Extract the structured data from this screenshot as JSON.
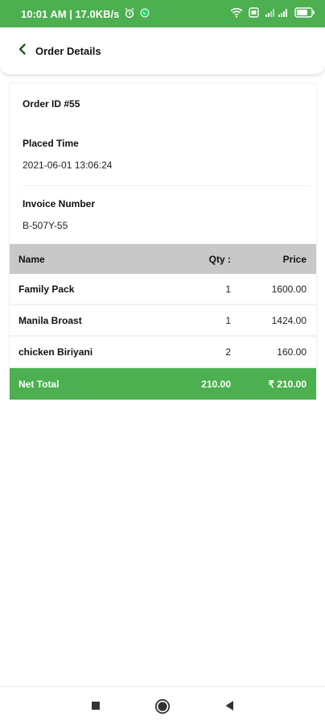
{
  "status_bar": {
    "time_speed": "10:01 AM | 17.0KB/s",
    "icons": [
      "alarm-icon",
      "whatsapp-icon",
      "wifi-icon",
      "sim-icon",
      "signal-icon",
      "battery-icon"
    ],
    "battery": "63",
    "bg_color": "#4CAF50"
  },
  "app_bar": {
    "title": "Order Details",
    "back_icon": "chevron-left-icon"
  },
  "order": {
    "order_id": "Order ID #55",
    "placed_label": "Placed Time",
    "placed_value": "2021-06-01 13:06:24",
    "invoice_label": "Invoice Number",
    "invoice_value": "B-507Y-55"
  },
  "table": {
    "headers": {
      "name": "Name",
      "qty": "Qty :",
      "price": "Price"
    },
    "items": [
      {
        "name": "Family Pack",
        "qty": "1",
        "price": "1600.00"
      },
      {
        "name": "Manila Broast",
        "qty": "1",
        "price": "1424.00"
      },
      {
        "name": "chicken Biriyani",
        "qty": "2",
        "price": "160.00"
      }
    ],
    "total": {
      "label": "Net Total",
      "qty_value": "210.00",
      "price_value": "₹ 210.00"
    }
  },
  "nav_bar": {
    "buttons": [
      "recents-square-icon",
      "home-circle-icon",
      "back-triangle-icon"
    ]
  },
  "colors": {
    "accent": "#4CAF50",
    "table_header": "#C8C8C8"
  }
}
